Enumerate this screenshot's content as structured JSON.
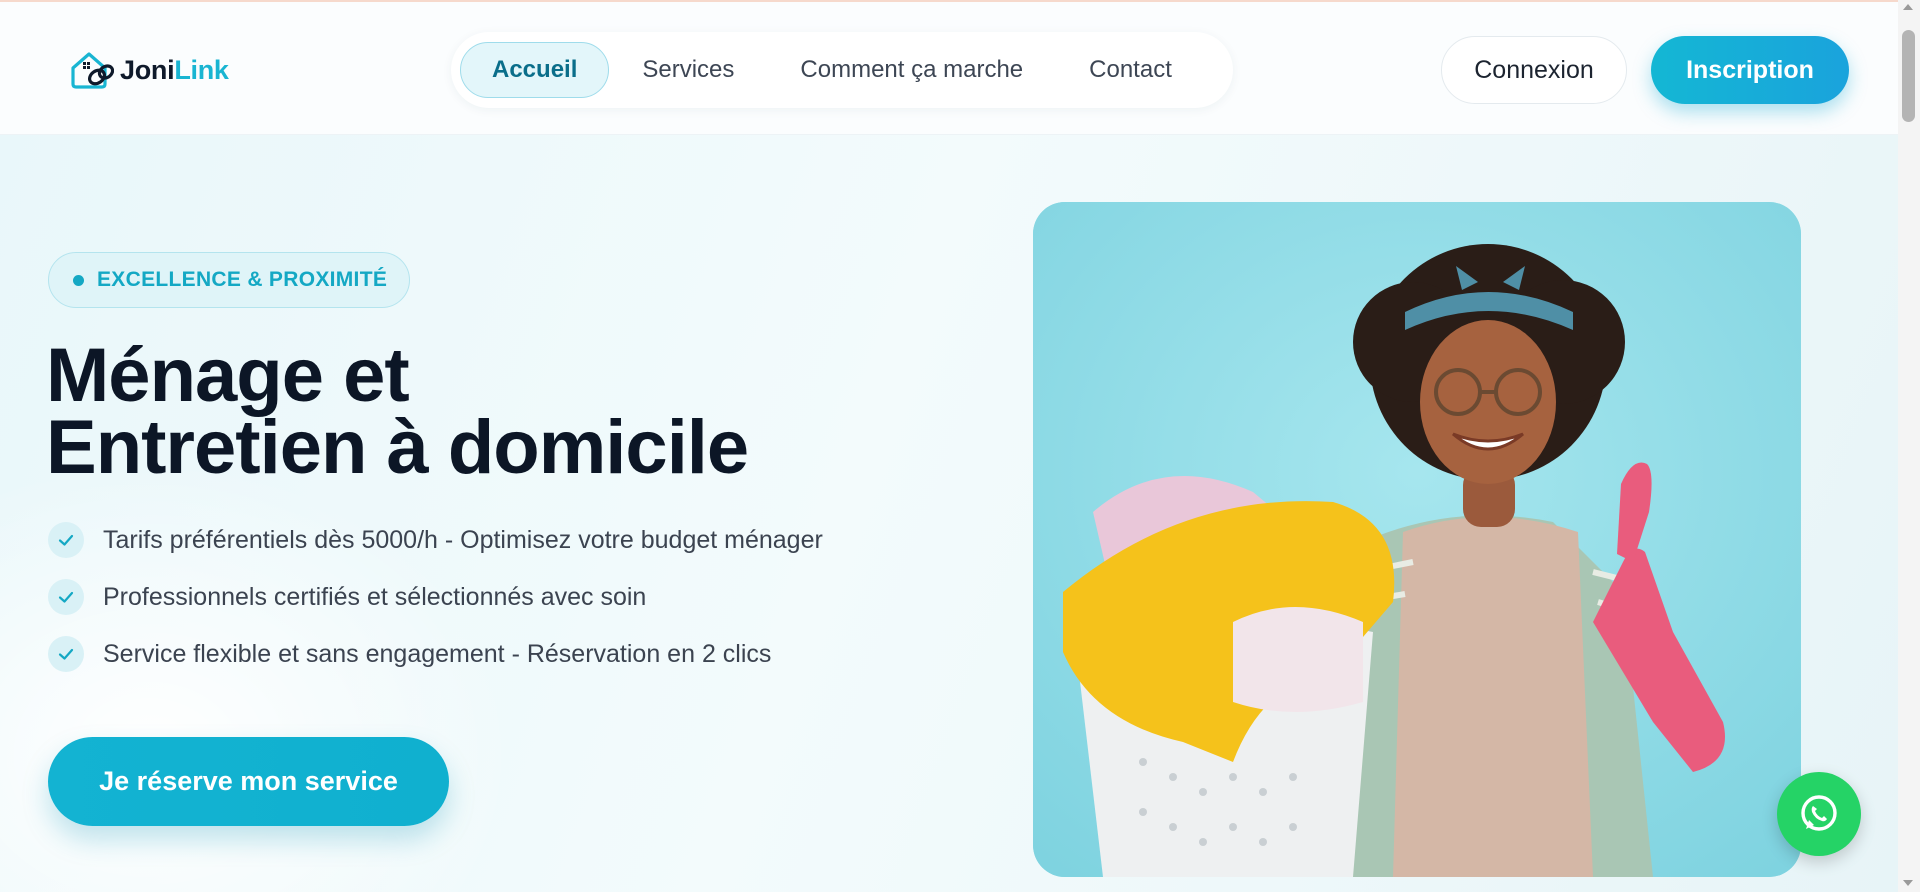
{
  "brand": {
    "name_part1": "Joni",
    "name_part2": "Link"
  },
  "nav": {
    "items": [
      {
        "label": "Accueil",
        "active": true
      },
      {
        "label": "Services",
        "active": false
      },
      {
        "label": "Comment ça marche",
        "active": false
      },
      {
        "label": "Contact",
        "active": false
      }
    ]
  },
  "auth": {
    "login_label": "Connexion",
    "signup_label": "Inscription"
  },
  "hero": {
    "badge": "EXCELLENCE & PROXIMITÉ",
    "title_line1": "Ménage et",
    "title_line2": "Entretien à domicile",
    "features": [
      "Tarifs préférentiels dès 5000/h - Optimisez votre budget ménager",
      "Professionnels certifiés et sélectionnés avec soin",
      "Service flexible et sans engagement - Réservation en 2 clics"
    ],
    "cta_label": "Je réserve mon service",
    "image_icon": "cleaning-woman-photo"
  },
  "floating": {
    "icon": "whatsapp-icon"
  },
  "colors": {
    "accent": "#14b7d4",
    "accent_dark": "#0a6e8a",
    "text_dark": "#0c1626",
    "whatsapp": "#25d366"
  }
}
